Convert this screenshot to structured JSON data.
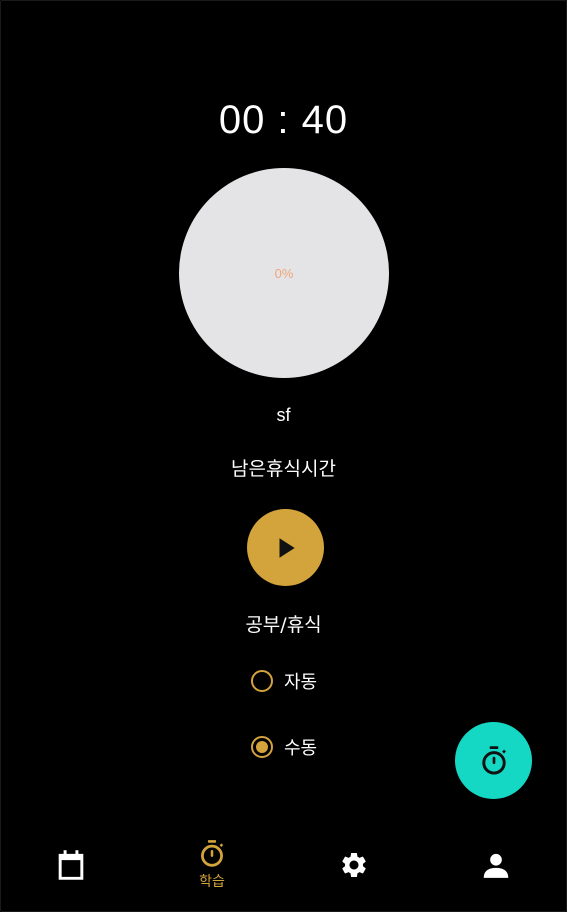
{
  "timer": {
    "display": "00 : 40"
  },
  "progress": {
    "label": "0%",
    "value": 0
  },
  "subject": {
    "name": "sf"
  },
  "status": {
    "text": "남은휴식시간"
  },
  "controls": {
    "play_icon": "play-icon"
  },
  "mode": {
    "label": "공부/휴식",
    "options": [
      {
        "label": "자동",
        "selected": false
      },
      {
        "label": "수동",
        "selected": true
      }
    ]
  },
  "fab": {
    "icon": "stopwatch-icon"
  },
  "bottom_nav": {
    "items": [
      {
        "icon": "calendar-icon",
        "label": "",
        "active": false
      },
      {
        "icon": "stopwatch-icon",
        "label": "학습",
        "active": true
      },
      {
        "icon": "gear-icon",
        "label": "",
        "active": false
      },
      {
        "icon": "person-icon",
        "label": "",
        "active": false
      }
    ]
  },
  "colors": {
    "background": "#000000",
    "accent": "#d3a33c",
    "fab": "#14d7c4",
    "progress_bg": "#e4e4e6",
    "progress_text": "#f0a57a"
  }
}
